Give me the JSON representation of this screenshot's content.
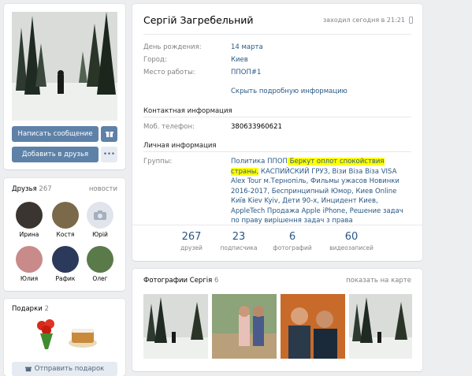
{
  "profile": {
    "name": "Сергій Загребельний",
    "last_seen": "заходил сегодня в 21:21",
    "fields": [
      {
        "label": "День рождения:",
        "value": "14 марта"
      },
      {
        "label": "Город:",
        "value": "Киев"
      },
      {
        "label": "Место работы:",
        "value": "ППОП#1"
      }
    ],
    "show_more": "Скрыть подробную информацию",
    "contact_header": "Контактная информация",
    "phone_label": "Моб. телефон:",
    "phone_value": "380633960621",
    "personal_header": "Личная информация",
    "groups_label": "Группы:",
    "groups_prefix": "Политика ППОП",
    "groups_highlight": " Беркут оплот спокойствия страны,",
    "groups_rest": "КАСПИЙСКИЙ ГРУЗ, Візи Віза Віза VISA Alex Tour м.Тернопіль, Фильмы ужасов Новинки 2016-2017, Беспринципный Юмор, Киев Online Київ Kiev Kyiv, Дети 90-х, Инцидент Киев, AppleTech Продажа Apple iPhone, Решение задач по праву вирішення задач з права",
    "counters": [
      {
        "num": "267",
        "cap": "друзей"
      },
      {
        "num": "23",
        "cap": "подписчика"
      },
      {
        "num": "6",
        "cap": "фотографий"
      },
      {
        "num": "60",
        "cap": "видеозаписей"
      }
    ]
  },
  "left": {
    "write_message": "Написать сообщение",
    "add_friend": "Добавить в друзья",
    "more": "•••"
  },
  "friends": {
    "title": "Друзья",
    "count": "267",
    "new_link": "новости",
    "items": [
      {
        "name": "Ирина",
        "color": "#3a3530"
      },
      {
        "name": "Костя",
        "color": "#7a6a4a"
      },
      {
        "name": "Юрій",
        "color": "#e1e5eb"
      },
      {
        "name": "Юлия",
        "color": "#c98a8a"
      },
      {
        "name": "Рафик",
        "color": "#2b3a5a"
      },
      {
        "name": "Олег",
        "color": "#5a7a4a"
      }
    ]
  },
  "gifts": {
    "title": "Подарки",
    "count": "2",
    "send": "Отправить подарок"
  },
  "photos": {
    "title": "Фотографии Сергія",
    "count": "6",
    "map_link": "показать на карте"
  }
}
